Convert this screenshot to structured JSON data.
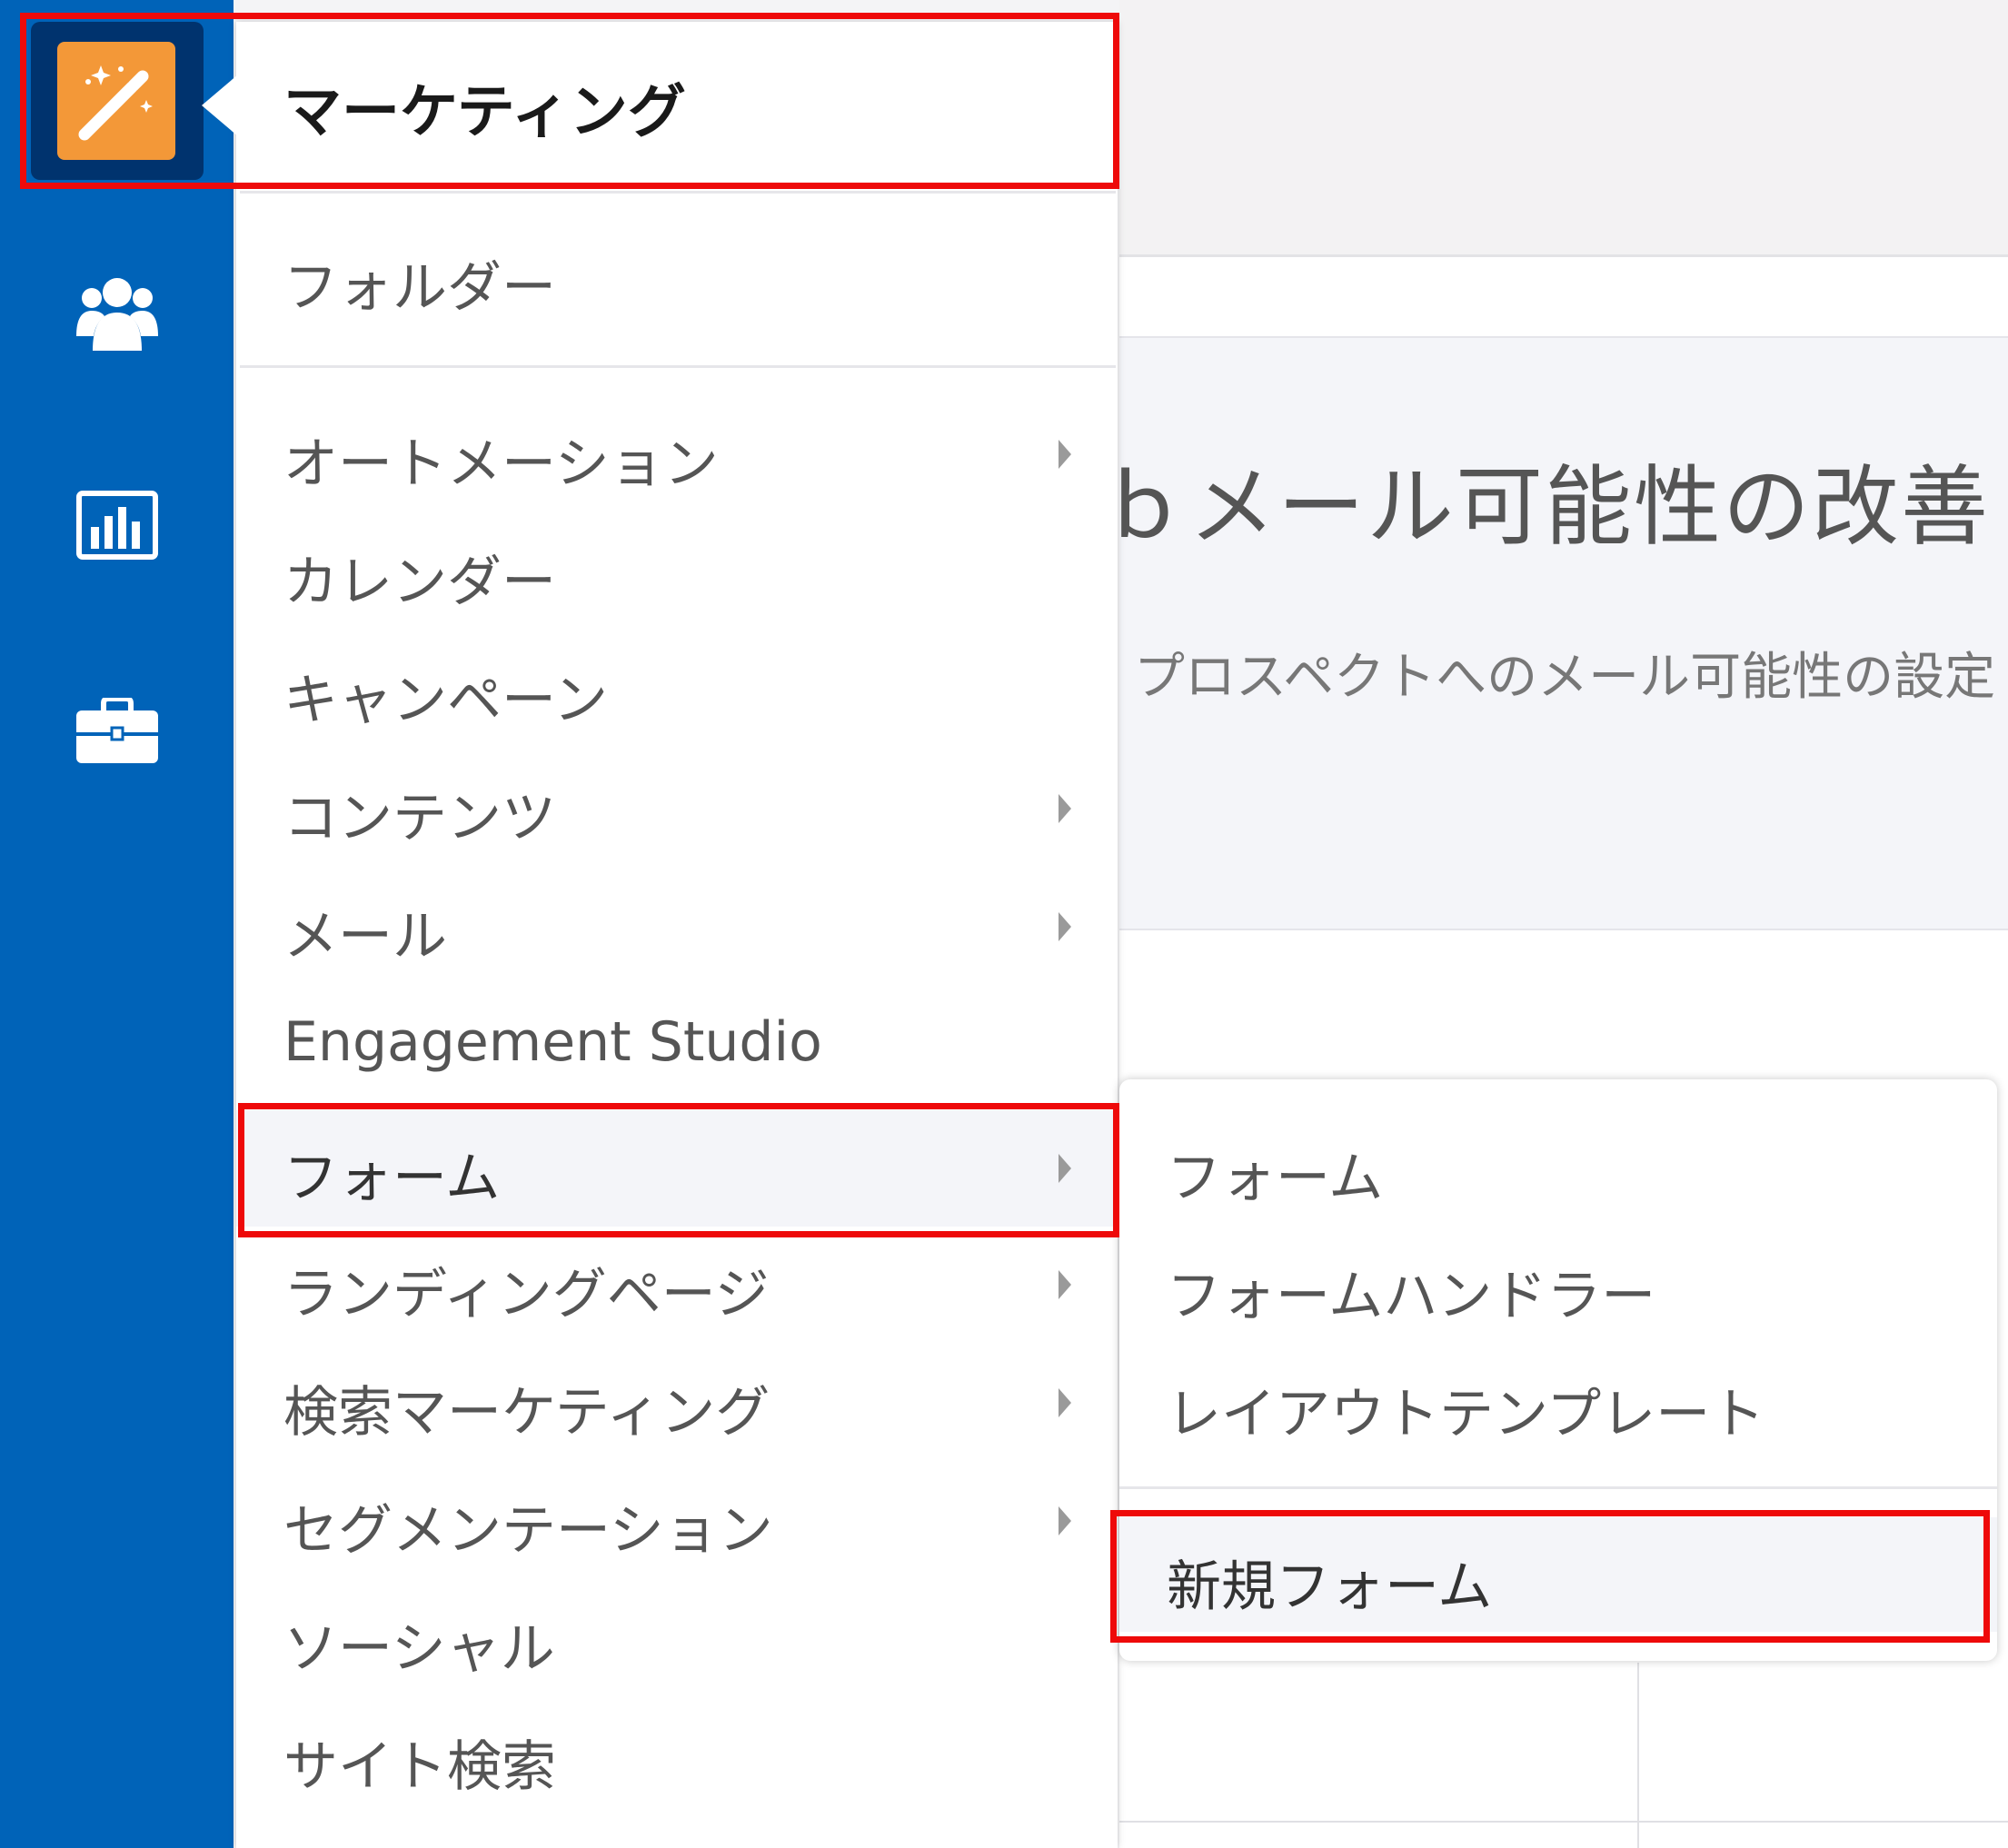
{
  "rail": {
    "items": [
      {
        "icon": "magic-wand-icon",
        "active": true
      },
      {
        "icon": "users-icon"
      },
      {
        "icon": "bar-chart-icon"
      },
      {
        "icon": "briefcase-icon"
      }
    ]
  },
  "background": {
    "title": "ｂメール可能性の改善",
    "subtitle": "プロスペクトへのメール可能性の設定"
  },
  "menu": {
    "header": "マーケティング",
    "items": [
      {
        "label": "フォルダー"
      },
      {
        "label": "オートメーション"
      },
      {
        "label": "カレンダー"
      },
      {
        "label": "キャンペーン"
      },
      {
        "label": "コンテンツ"
      },
      {
        "label": "メール"
      },
      {
        "label": "Engagement Studio"
      },
      {
        "label": "フォーム"
      },
      {
        "label": "ランディングページ"
      },
      {
        "label": "検索マーケティング"
      },
      {
        "label": "セグメンテーション"
      },
      {
        "label": "ソーシャル"
      },
      {
        "label": "サイト検索"
      }
    ]
  },
  "submenu": {
    "items": [
      {
        "label": "フォーム"
      },
      {
        "label": "フォームハンドラー"
      },
      {
        "label": "レイアウトテンプレート"
      },
      {
        "label": "新規フォーム"
      }
    ]
  },
  "colors": {
    "rail": "#0063b8",
    "app_tile": "#f39838",
    "highlight": "#ee0a0a"
  }
}
